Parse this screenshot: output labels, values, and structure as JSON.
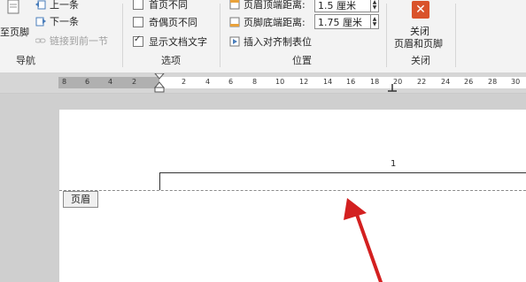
{
  "ribbon": {
    "nav": {
      "goto_footer": "至页脚",
      "previous": "上一条",
      "next": "下一条",
      "link_previous": "链接到前一节",
      "group_label": "导航"
    },
    "options": {
      "first_page": "首页不同",
      "odd_even": "奇偶页不同",
      "show_doc_text": "显示文档文字",
      "group_label": "选项"
    },
    "position": {
      "header_top_label": "页眉顶端距离:",
      "header_top_value": "1.5 厘米",
      "footer_bottom_label": "页脚底端距离:",
      "footer_bottom_value": "1.75 厘米",
      "insert_align_tab": "插入对齐制表位",
      "group_label": "位置"
    },
    "close": {
      "label_line1": "关闭",
      "label_line2": "页眉和页脚",
      "group_label": "关闭"
    }
  },
  "ruler": {
    "ticks": [
      "8",
      "6",
      "4",
      "2",
      "2",
      "4",
      "6",
      "8",
      "10",
      "12",
      "14",
      "16",
      "18",
      "20",
      "22",
      "24",
      "26",
      "28",
      "30"
    ]
  },
  "document": {
    "page_number": "1",
    "header_tag": "页眉"
  },
  "colors": {
    "close_button": "#d9532b",
    "annotation_arrow": "#d32020"
  }
}
